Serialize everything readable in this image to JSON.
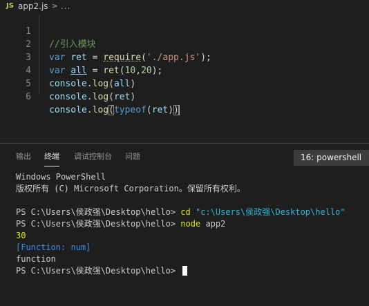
{
  "breadcrumb": {
    "file_icon": "JS",
    "file_name": "app2.js",
    "separator": ">",
    "more": "..."
  },
  "editor": {
    "lines": [
      {
        "number": "1"
      },
      {
        "number": "2"
      },
      {
        "number": "3"
      },
      {
        "number": "4"
      },
      {
        "number": "5"
      },
      {
        "number": "6"
      }
    ],
    "tokens": {
      "l1_comment": "//引入模块",
      "l2_kw": "var",
      "l2_var": "ret",
      "l2_eq": " = ",
      "l2_fn": "require",
      "l2_open": "(",
      "l2_str": "'./app.js'",
      "l2_close": ");",
      "l3_kw": "var",
      "l3_var": "all",
      "l3_eq": " = ",
      "l3_fn": "ret",
      "l3_open": "(",
      "l3_n1": "10",
      "l3_comma": ",",
      "l3_n2": "20",
      "l3_close": ");",
      "l4_obj": "console",
      "l4_dot": ".",
      "l4_fn": "log",
      "l4_open": "(",
      "l4_arg": "all",
      "l4_close": ")",
      "l5_obj": "console",
      "l5_dot": ".",
      "l5_fn": "log",
      "l5_open": "(",
      "l5_arg": "ret",
      "l5_close": ")",
      "l6_obj": "console",
      "l6_dot": ".",
      "l6_fn": "log",
      "l6_open": "(",
      "l6_kw": "typeof",
      "l6_open2": "(",
      "l6_arg": "ret",
      "l6_close2": ")",
      "l6_close": ")"
    }
  },
  "panel": {
    "tabs": [
      {
        "label": "输出"
      },
      {
        "label": "终端"
      },
      {
        "label": "调试控制台"
      },
      {
        "label": "问题"
      }
    ],
    "active_tab": "终端",
    "terminal_selector": "16: powershell"
  },
  "terminal": {
    "banner1": "Windows PowerShell",
    "banner2": "版权所有 (C) Microsoft Corporation。保留所有权利。",
    "prompt": "PS C:\\Users\\侯政强\\Desktop\\hello> ",
    "cmd1_name": "cd",
    "cmd1_arg": "\"c:\\Users\\侯政强\\Desktop\\hello\"",
    "cmd2_name": "node",
    "cmd2_arg": "app2",
    "out1": "30",
    "out2": "[Function: num]",
    "out3": "function"
  },
  "colors": {
    "background": "#1e1e1e",
    "comment": "#6a9955",
    "keyword": "#569cd6",
    "variable": "#9cdcfe",
    "function": "#dcdcaa",
    "string": "#ce9178",
    "number": "#b5cea8",
    "terminal_number": "#e5e510",
    "terminal_function": "#3b8eea"
  }
}
